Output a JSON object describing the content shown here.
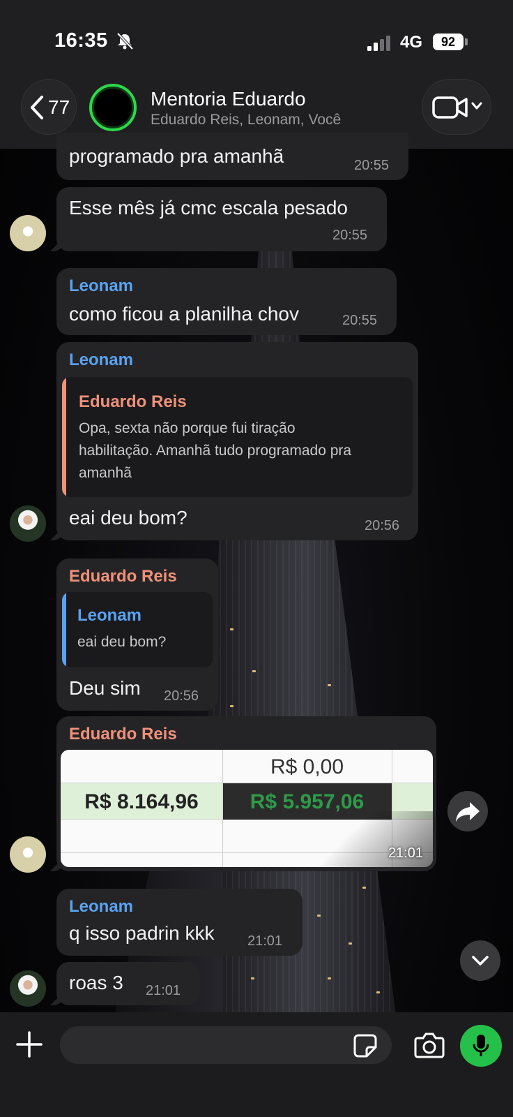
{
  "status_bar": {
    "time": "16:35",
    "network": "4G",
    "battery": "92"
  },
  "header": {
    "back_count": "77",
    "title": "Mentoria Eduardo",
    "subtitle": "Eduardo Reis, Leonam, Você"
  },
  "messages": [
    {
      "text": "programado pra amanhã",
      "time": "20:55"
    },
    {
      "text": "Esse mês já cmc escala pesado",
      "time": "20:55"
    },
    {
      "sender": "Leonam",
      "text": "como ficou a planilha chov",
      "time": "20:55"
    },
    {
      "sender": "Leonam",
      "quote": {
        "sender": "Eduardo Reis",
        "text_line1": "Opa, sexta não porque fui tiração",
        "text_line2": "habilitação. Amanhã tudo programado pra",
        "text_line3": "amanhã"
      },
      "text": "eai deu bom?",
      "time": "20:56"
    },
    {
      "sender": "Eduardo Reis",
      "quote": {
        "sender": "Leonam",
        "text": "eai deu bom?"
      },
      "text": "Deu sim",
      "time": "20:56"
    },
    {
      "sender": "Eduardo Reis",
      "image": {
        "cell_top": "R$ 0,00",
        "cell_left": "R$ 8.164,96",
        "cell_right": "R$ 5.957,06"
      },
      "time": "21:01"
    },
    {
      "sender": "Leonam",
      "text": "q isso padrin kkk",
      "time": "21:01"
    },
    {
      "text": "roas 3",
      "time": "21:01"
    }
  ],
  "composer": {
    "placeholder": ""
  },
  "colors": {
    "accent_green": "#25c04a",
    "sender_blue": "#5aa2f0",
    "sender_orange": "#f0917a",
    "sheet_green": "#2e9a4a"
  }
}
